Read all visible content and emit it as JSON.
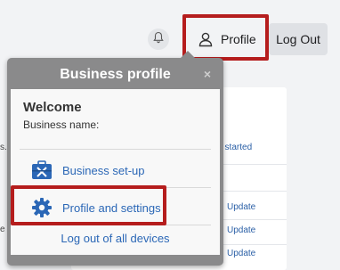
{
  "header": {
    "profile_label": "Profile",
    "logout_label": "Log Out"
  },
  "background": {
    "started_link": "t started",
    "update_links": [
      "Update",
      "Update",
      "Update"
    ],
    "clipped_left_1": "s.",
    "clipped_left_2": "e"
  },
  "popover": {
    "title": "Business profile",
    "close": "×",
    "welcome": "Welcome",
    "business_name_label": "Business name:",
    "items": [
      {
        "label": "Business set-up",
        "icon": "toolbox-icon"
      },
      {
        "label": "Profile and settings",
        "icon": "gear-icon"
      }
    ],
    "logout_all": "Log out of all devices"
  },
  "colors": {
    "link_blue": "#2b67b6",
    "highlight_red": "#b51d1d",
    "popover_gray": "#8a8a8b"
  }
}
